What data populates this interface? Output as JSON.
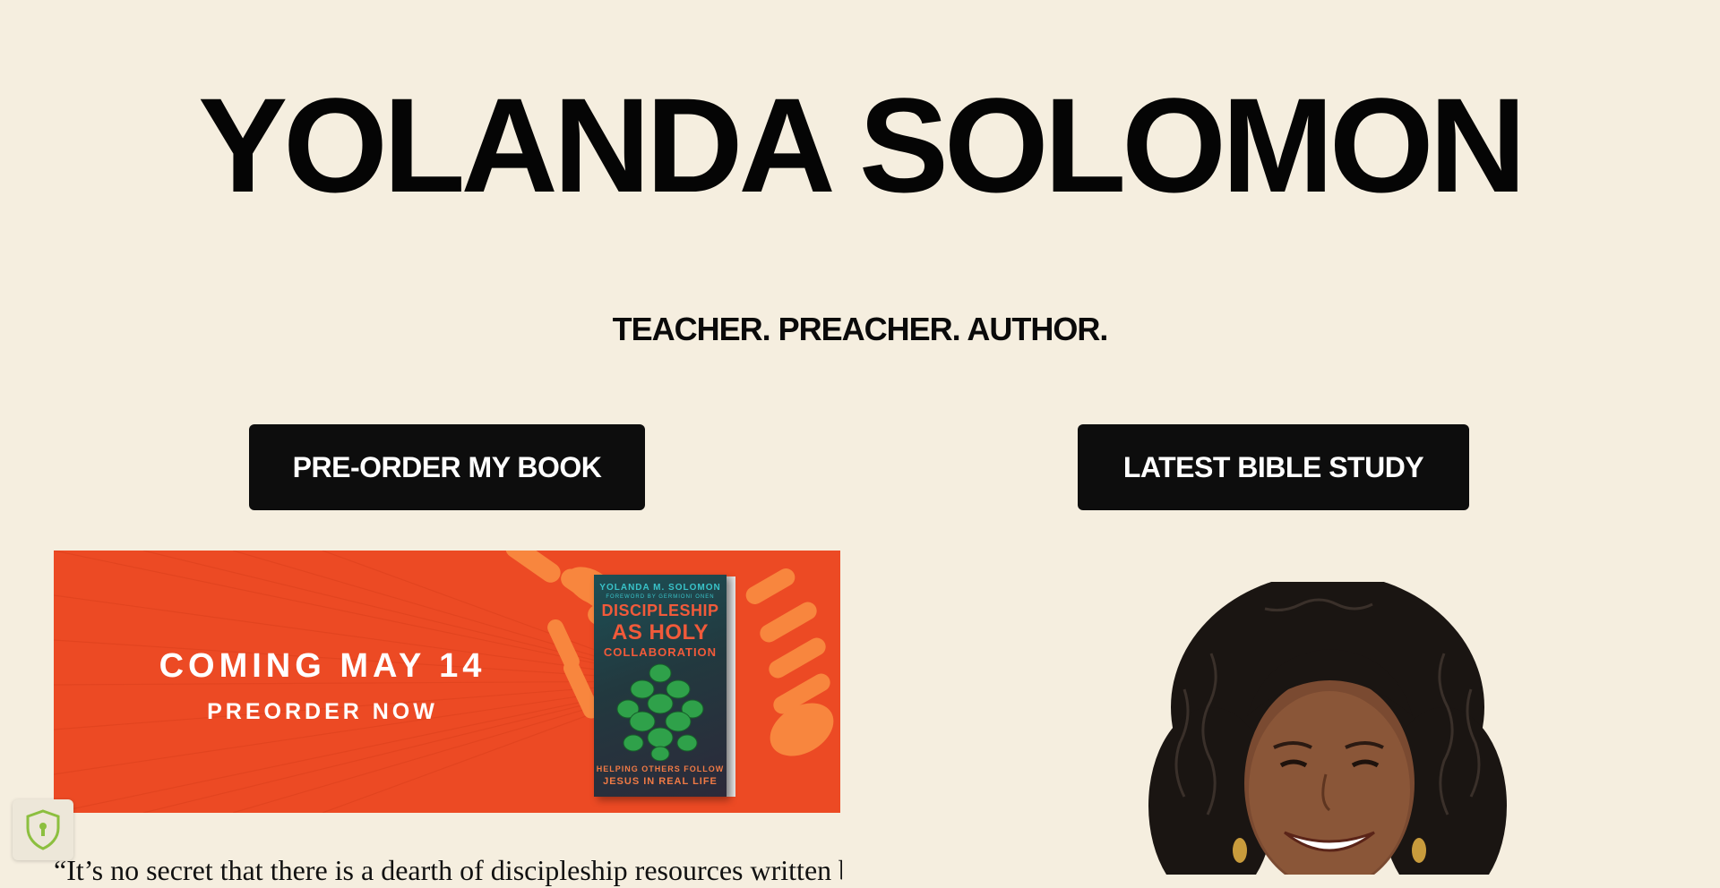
{
  "header": {
    "title": "YOLANDA SOLOMON",
    "tagline": "TEACHER. PREACHER. AUTHOR."
  },
  "buttons": {
    "preorder_label": "PRE-ORDER MY BOOK",
    "bible_study_label": "LATEST BIBLE STUDY"
  },
  "banner": {
    "line1": "COMING MAY 14",
    "line2": "PREORDER NOW",
    "background_color": "#ec4a24",
    "book": {
      "author": "YOLANDA M. SOLOMON",
      "foreword": "FOREWORD BY GERMIONI ONEN",
      "title_line1": "DISCIPLESHIP",
      "title_line2": "AS HOLY",
      "title_line3": "COLLABORATION",
      "subtitle_line1": "HELPING OTHERS FOLLOW",
      "subtitle_line2": "JESUS IN REAL LIFE"
    }
  },
  "intro": {
    "quote_start": "“It’s no secret that there is a dearth of discipleship resources written by"
  },
  "privacy": {
    "icon": "shield-lock-icon"
  },
  "colors": {
    "page_background": "#f5eedf",
    "button_background": "#0d0d0d",
    "button_text": "#ffffff",
    "accent_orange": "#ec4a24"
  }
}
